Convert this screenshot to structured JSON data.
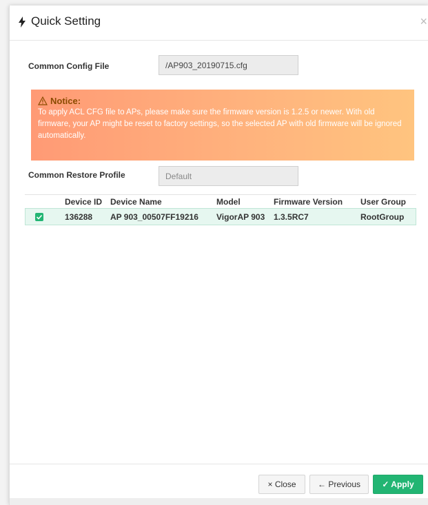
{
  "modal": {
    "title": "Quick Setting",
    "close_glyph": "×"
  },
  "config": {
    "common_config_label": "Common Config File",
    "common_config_value": "/AP903_20190715.cfg",
    "restore_profile_label": "Common Restore Profile",
    "restore_profile_value": "Default"
  },
  "notice": {
    "heading": "Notice:",
    "text": "To apply ACL CFG file to APs, please make sure the firmware version is 1.2.5 or newer. With old firmware, your AP might be reset to factory settings, so the selected AP with old firmware will be ignored automatically."
  },
  "table": {
    "headers": {
      "device_id": "Device ID",
      "device_name": "Device Name",
      "model": "Model",
      "firmware_version": "Firmware Version",
      "user_group": "User Group"
    },
    "rows": [
      {
        "checked": true,
        "device_id": "136288",
        "device_name": "AP 903_00507FF19216",
        "model": "VigorAP 903",
        "firmware_version": "1.3.5RC7",
        "user_group": "RootGroup"
      }
    ]
  },
  "footer": {
    "close_label": "× Close",
    "previous_label": "← Previous",
    "apply_label": "✓ Apply"
  },
  "colors": {
    "accent_green": "#22b573",
    "notice_start": "#ff9a75",
    "notice_end": "#ffc47f"
  }
}
